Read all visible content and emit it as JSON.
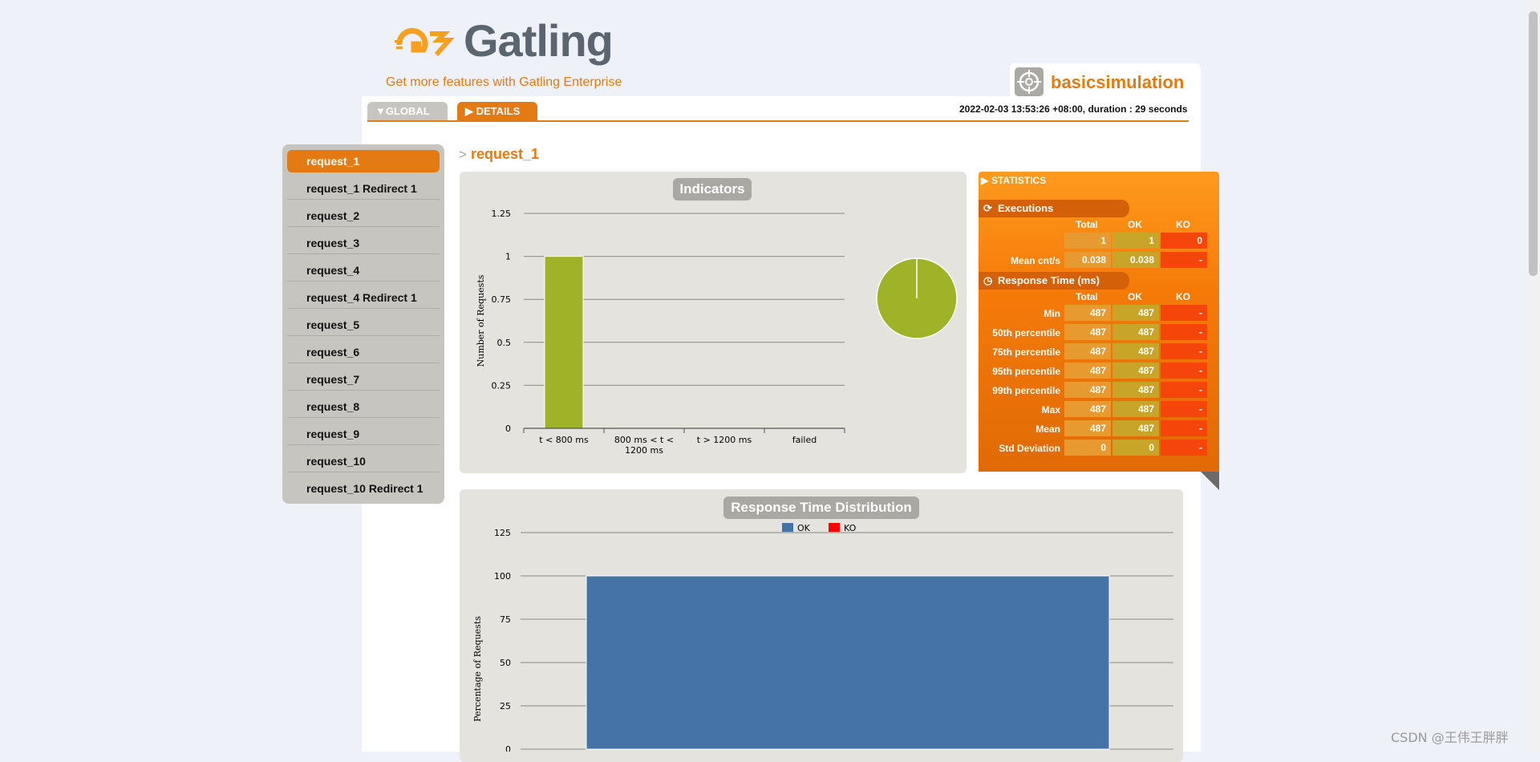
{
  "brand": {
    "name": "Gatling",
    "enterprise_link": "Get more features with Gatling Enterprise"
  },
  "simulation": {
    "name": "basicsimulation",
    "run_info": "2022-02-03 13:53:26 +08:00, duration : 29 seconds"
  },
  "tabs": [
    {
      "label": "GLOBAL",
      "icon": "triangle-down-icon"
    },
    {
      "label": "DETAILS",
      "icon": "triangle-right-icon"
    }
  ],
  "sidebar": {
    "items": [
      {
        "label": "request_1",
        "active": true
      },
      {
        "label": "request_1 Redirect 1"
      },
      {
        "label": "request_2"
      },
      {
        "label": "request_3"
      },
      {
        "label": "request_4"
      },
      {
        "label": "request_4 Redirect 1"
      },
      {
        "label": "request_5"
      },
      {
        "label": "request_6"
      },
      {
        "label": "request_7"
      },
      {
        "label": "request_8"
      },
      {
        "label": "request_9"
      },
      {
        "label": "request_10"
      },
      {
        "label": "request_10 Redirect 1"
      }
    ]
  },
  "request": {
    "arrow": ">",
    "title": "request_1"
  },
  "statistics": {
    "title": "STATISTICS",
    "executions": {
      "label": "Executions",
      "columns": [
        "Total",
        "OK",
        "KO"
      ],
      "rows": [
        {
          "label": "",
          "values": [
            "1",
            "1",
            "0"
          ]
        },
        {
          "label": "Mean cnt/s",
          "values": [
            "0.038",
            "0.038",
            "-"
          ]
        }
      ]
    },
    "response_time": {
      "label": "Response Time (ms)",
      "columns": [
        "Total",
        "OK",
        "KO"
      ],
      "rows": [
        {
          "label": "Min",
          "values": [
            "487",
            "487",
            "-"
          ]
        },
        {
          "label": "50th percentile",
          "values": [
            "487",
            "487",
            "-"
          ]
        },
        {
          "label": "75th percentile",
          "values": [
            "487",
            "487",
            "-"
          ]
        },
        {
          "label": "95th percentile",
          "values": [
            "487",
            "487",
            "-"
          ]
        },
        {
          "label": "99th percentile",
          "values": [
            "487",
            "487",
            "-"
          ]
        },
        {
          "label": "Max",
          "values": [
            "487",
            "487",
            "-"
          ]
        },
        {
          "label": "Mean",
          "values": [
            "487",
            "487",
            "-"
          ]
        },
        {
          "label": "Std Deviation",
          "values": [
            "0",
            "0",
            "-"
          ]
        }
      ]
    }
  },
  "colors": {
    "accent": "#e37a14",
    "ok": "#4572a7",
    "ko": "#ff0000",
    "bar": "#a0b228"
  },
  "chart_data": [
    {
      "type": "bar",
      "title": "Indicators",
      "categories": [
        "t < 800 ms",
        "800 ms < t < 1200 ms",
        "t > 1200 ms",
        "failed"
      ],
      "values": [
        1,
        0,
        0,
        0
      ],
      "ylabel": "Number of Requests",
      "ylim": [
        0,
        1.25
      ],
      "yticks": [
        "0",
        "0.25",
        "0.5",
        "0.75",
        "1",
        "1.25"
      ],
      "pie": {
        "values": [
          1
        ]
      }
    },
    {
      "type": "bar",
      "title": "Response Time Distribution",
      "legend": [
        "OK",
        "KO"
      ],
      "ylabel": "Percentage of Requests",
      "ylim": [
        0,
        125
      ],
      "yticks": [
        "0",
        "25",
        "50",
        "75",
        "100",
        "125"
      ],
      "series": [
        {
          "name": "OK",
          "values": [
            100
          ]
        },
        {
          "name": "KO",
          "values": [
            0
          ]
        }
      ]
    }
  ],
  "watermark": "CSDN @王伟王胖胖"
}
